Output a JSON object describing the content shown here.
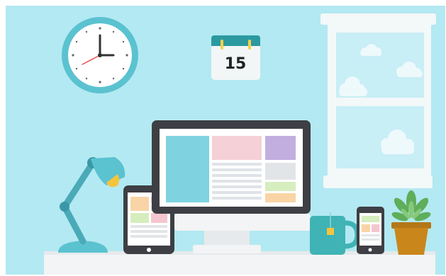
{
  "calendar": {
    "day": "15"
  },
  "colors": {
    "wall": "#b3e9f2",
    "clock_ring": "#5bc2d0",
    "desk": "#f2f4f5",
    "monitor_frame": "#3d3f44",
    "lamp": "#5bc2d0",
    "window_frame": "#f3f8f9",
    "plant_pot": "#c9861b",
    "mug": "#3fb3b5",
    "calendar_top": "#2b9aa0"
  },
  "icons": [
    "wall-clock-icon",
    "calendar-icon",
    "window-icon",
    "desk-lamp-icon",
    "tablet-icon",
    "monitor-icon",
    "mug-icon",
    "phone-icon",
    "plant-icon"
  ]
}
